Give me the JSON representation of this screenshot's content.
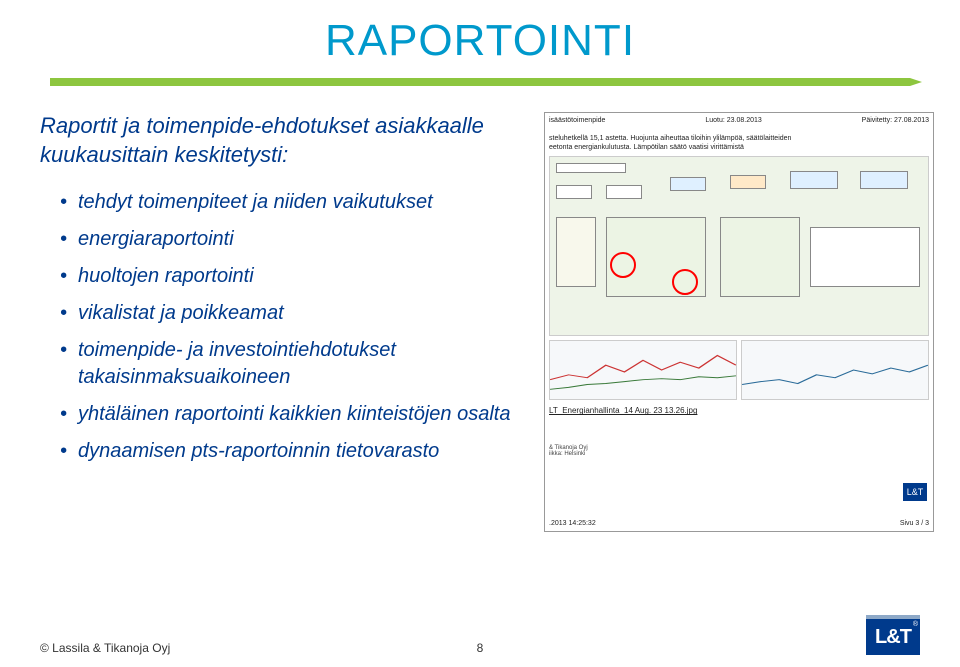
{
  "title": "RAPORTOINTI",
  "subhead": "Raportit ja toimenpide-ehdotukset asiakkaalle kuukausittain keskitetysti:",
  "bullets": [
    "tehdyt toimenpiteet ja niiden vaikutukset",
    "energiaraportointi",
    "huoltojen raportointi",
    "vikalistat ja poikkeamat",
    "toimenpide- ja investointiehdotukset takaisinmaksuaikoineen",
    "yhtäläinen raportointi kaikkien kiinteistöjen osalta",
    "dynaamisen pts-raportoinnin tietovarasto"
  ],
  "report": {
    "header_left": "isäästötoimenpide",
    "header_mid": "Luotu: 23.08.2013",
    "header_right": "Päivitetty: 27.08.2013",
    "note_line1": "steluhetkellä 15,1 astetta. Huojunta aiheuttaa tiloihin ylilämpöä, säätölaitteiden",
    "note_line2": "eetonta energiankulutusta. Lämpötilan säätö vaatisi virittämistä",
    "file_label": "LT_Energianhallinta_14 Aug. 23 13.26.jpg",
    "company1": "& Tikanoja Oyj",
    "company2": "iikka: Helsinki",
    "footer_time": ".2013 14:25:32",
    "footer_page": "Sivu 3 / 3"
  },
  "footer": {
    "copyright": "© Lassila & Tikanoja Oyj",
    "pagenum": "8"
  },
  "logo_text": "L&T",
  "logo_reg": "®"
}
